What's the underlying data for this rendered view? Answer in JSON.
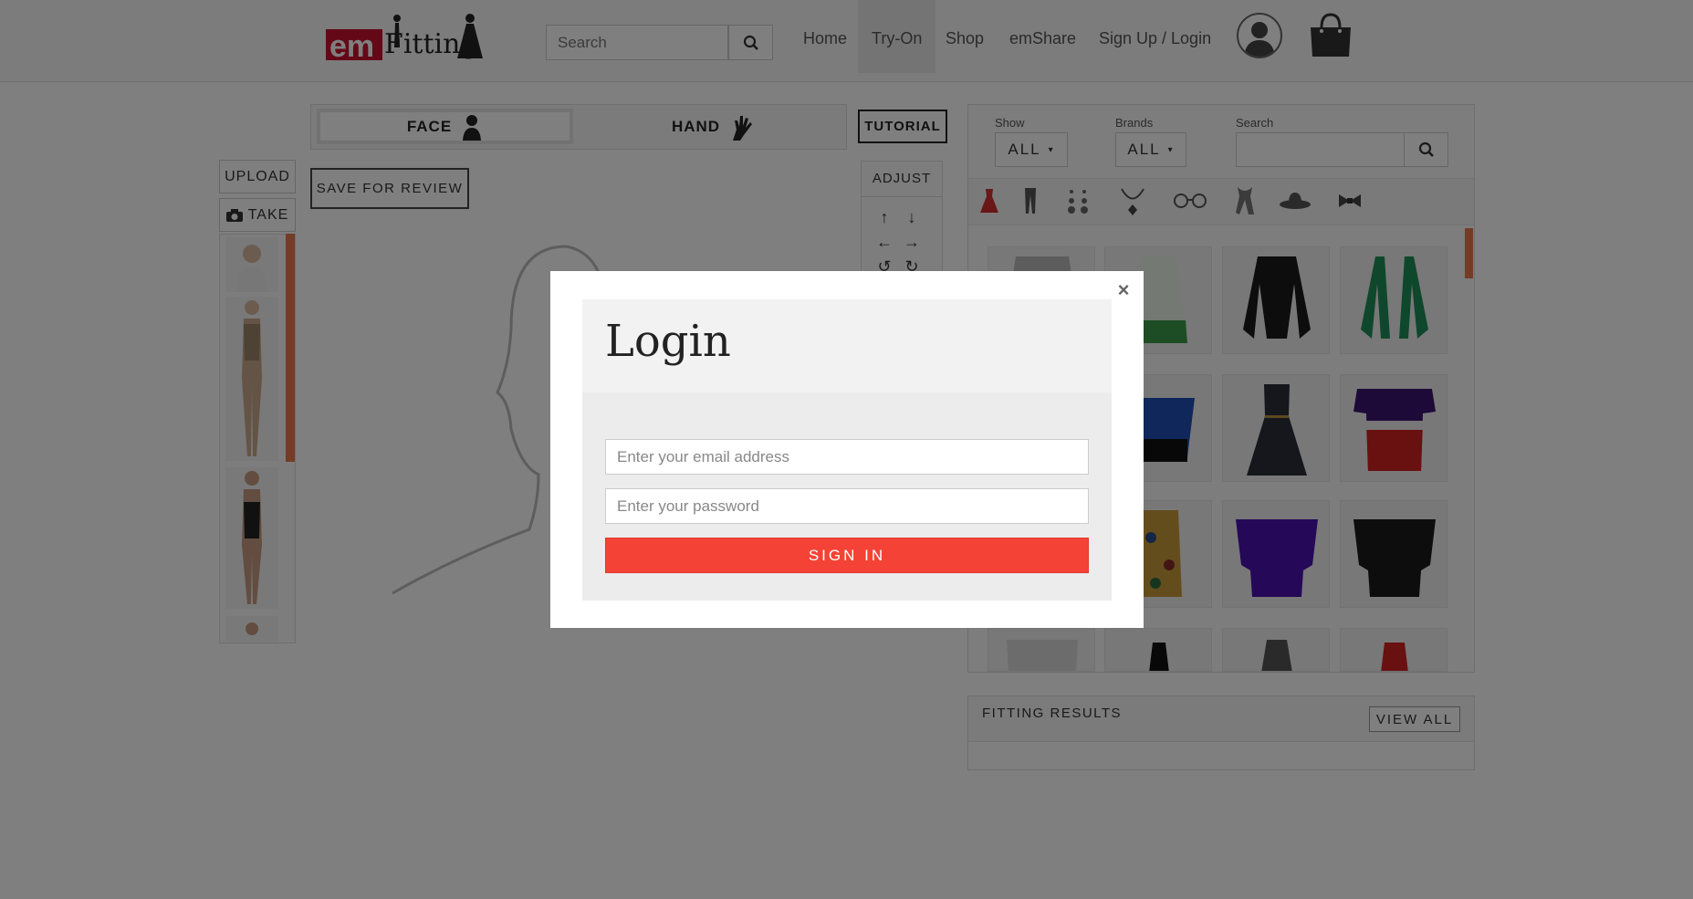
{
  "header": {
    "search_placeholder": "Search",
    "nav": {
      "home": "Home",
      "tryon": "Try-On",
      "shop": "Shop",
      "emshare": "emShare",
      "signup": "Sign Up / Login"
    }
  },
  "tryon": {
    "face_label": "FACE",
    "hand_label": "HAND",
    "tutorial": "TUTORIAL",
    "upload": "UPLOAD",
    "take": "TAKE",
    "save_review": "SAVE FOR REVIEW",
    "adjust": "ADJUST"
  },
  "products": {
    "show_label": "Show",
    "show_value": "ALL",
    "brands_label": "Brands",
    "brands_value": "ALL",
    "search_label": "Search",
    "categories": [
      "dress-icon",
      "pants-icon",
      "earrings-icon",
      "necklace-icon",
      "glasses-icon",
      "scarf-icon",
      "hat-icon",
      "bowtie-icon"
    ]
  },
  "results": {
    "title": "FITTING RESULTS",
    "view_all": "VIEW ALL"
  },
  "modal": {
    "title": "Login",
    "email_placeholder": "Enter your email address",
    "password_placeholder": "Enter your password",
    "signin": "SIGN IN",
    "close": "×"
  },
  "colors": {
    "accent_red": "#f44336",
    "scroll_orange": "#e8764f"
  }
}
